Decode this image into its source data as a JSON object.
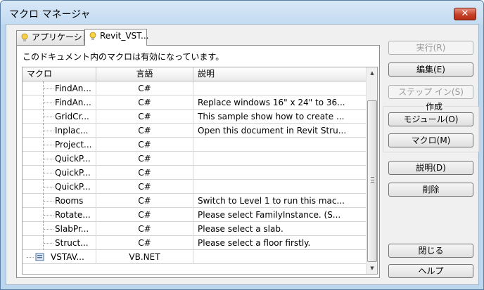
{
  "window": {
    "title": "マクロ マネージャ",
    "close_label": "✕"
  },
  "tabs": [
    {
      "label": "アプリケーション",
      "active": false
    },
    {
      "label": "Revit_VST...",
      "active": true
    }
  ],
  "panel": {
    "caption": "このドキュメント内のマクロは有効になっています。"
  },
  "grid": {
    "headers": [
      "マクロ",
      "言語",
      "説明"
    ],
    "rows": [
      {
        "name": "FindAn...",
        "lang": "C#",
        "desc": ""
      },
      {
        "name": "FindAn...",
        "lang": "C#",
        "desc": "Replace windows 16\" x 24\" to 36..."
      },
      {
        "name": "GridCr...",
        "lang": "C#",
        "desc": "This sample show how to create ..."
      },
      {
        "name": "Inplac...",
        "lang": "C#",
        "desc": "Open this document in Revit Stru..."
      },
      {
        "name": "Project...",
        "lang": "C#",
        "desc": ""
      },
      {
        "name": "QuickP...",
        "lang": "C#",
        "desc": ""
      },
      {
        "name": "QuickP...",
        "lang": "C#",
        "desc": ""
      },
      {
        "name": "QuickP...",
        "lang": "C#",
        "desc": ""
      },
      {
        "name": "Rooms",
        "lang": "C#",
        "desc": "Switch to Level 1 to run this mac..."
      },
      {
        "name": "Rotate...",
        "lang": "C#",
        "desc": "Please select FamilyInstance. (S..."
      },
      {
        "name": "SlabPr...",
        "lang": "C#",
        "desc": "Please select a slab."
      },
      {
        "name": "Struct...",
        "lang": "C#",
        "desc": "Please select a floor firstly."
      },
      {
        "name": "VSTAV...",
        "lang": "VB.NET",
        "desc": ""
      }
    ]
  },
  "buttons": {
    "run": "実行(R)",
    "edit": "編集(E)",
    "step_into": "ステップ イン(S)",
    "create_group": "作成",
    "module": "モジュール(O)",
    "macro": "マクロ(M)",
    "description": "説明(D)",
    "delete": "削除",
    "close": "閉じる",
    "help": "ヘルプ"
  }
}
